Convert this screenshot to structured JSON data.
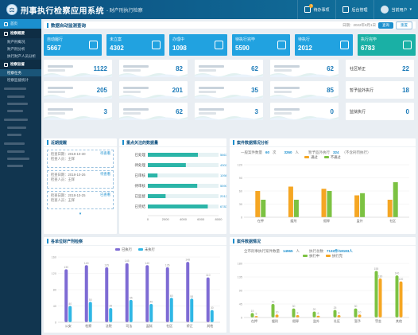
{
  "header": {
    "title": "刑事执行检察应用系统",
    "subtitle": "- 财产刑执行检察",
    "btn_tasks": "待办事项",
    "tasks_count": "1",
    "btn_manage": "后台管理",
    "user": "当前用户"
  },
  "sidebar": {
    "home": "首页",
    "overview_group": "检察概要",
    "items": [
      "财产刑概况",
      "财产刑分析",
      "执行财产人员分析"
    ],
    "data_group": "检察监督",
    "sel_items": [
      "检察任务",
      "检察监督统计"
    ]
  },
  "topbar": {
    "title": "数据自动监测查询",
    "date_text": "日期：2022年9月1日",
    "btn_query": "查询",
    "btn_reset": "重置"
  },
  "kpis": [
    {
      "label": "自动履行",
      "value": "5667"
    },
    {
      "label": "未立案",
      "value": "4302"
    },
    {
      "label": "办理中",
      "value": "1098"
    },
    {
      "label": "待执行完毕",
      "value": "5590"
    },
    {
      "label": "待执行",
      "value": "2012"
    },
    {
      "label": "执行完毕",
      "value": "6783"
    }
  ],
  "cards": [
    {
      "value": "1122"
    },
    {
      "value": "82"
    },
    {
      "value": "62"
    },
    {
      "value": "62"
    },
    {
      "label": "社区矫正",
      "value": "22"
    },
    {
      "value": "205"
    },
    {
      "value": "201"
    },
    {
      "value": "35"
    },
    {
      "value": "85"
    },
    {
      "label": "暂予监外执行",
      "value": "18"
    },
    {
      "value": "3"
    },
    {
      "value": "62"
    },
    {
      "value": "3"
    },
    {
      "value": "0"
    },
    {
      "label": "监狱执行",
      "value": "0"
    }
  ],
  "panels": {
    "recent": "近期提醒",
    "focus": "重点关注的数据量",
    "supervise": "案件数据情况分析",
    "compare": "各单位财产刑检察",
    "status": "案件数据情况"
  },
  "recent_items": [
    {
      "l1": "检查日期：2018-10-30",
      "l2": "检查人员：王辉",
      "tag": "待查看"
    },
    {
      "l1": "检查日期：2018-10-26",
      "l2": "检查人员：王辉",
      "tag": "待查看"
    },
    {
      "l1": "检查日期：2018-10-25",
      "l2": "检查人员：王辉",
      "tag": "已查看"
    }
  ],
  "focus_chart": {
    "type": "bar",
    "categories": [
      "已处理",
      "待处理",
      "已审核",
      "待审核",
      "已监督",
      "已完结"
    ],
    "values": [
      5667,
      4302,
      1098,
      5590,
      2012,
      6783
    ],
    "xticks": [
      "0",
      "2000",
      "4000",
      "6000",
      "8000"
    ],
    "xlim": [
      0,
      8000
    ]
  },
  "sup_head": {
    "t1": "一般案件数量",
    "v1": "60",
    "u1": "次",
    "v1b": "3260",
    "u1b": "人",
    "t2": "暂予监外执行",
    "v2": "324",
    "note": "（不含刑罚执行）"
  },
  "sup_chart": {
    "type": "bar",
    "categories": [
      "在押",
      "缓刑",
      "假释",
      "监外",
      "社区"
    ],
    "series": [
      {
        "name": "通过",
        "color": "#f5a623",
        "values": [
          60,
          70,
          65,
          50,
          40
        ]
      },
      {
        "name": "不通过",
        "color": "#7cc242",
        "values": [
          40,
          40,
          60,
          55,
          80
        ]
      }
    ],
    "ylim": [
      0,
      120
    ]
  },
  "cmp_chart": {
    "type": "bar",
    "categories": [
      "公安",
      "检察",
      "法院",
      "司法",
      "监狱",
      "社区",
      "矫正",
      "其他"
    ],
    "series": [
      {
        "name": "已执行",
        "color": "#7e6bd4",
        "values": [
          130,
          140,
          135,
          145,
          140,
          135,
          148,
          110
        ]
      },
      {
        "name": "未执行",
        "color": "#2fb7e5",
        "values": [
          40,
          50,
          35,
          55,
          45,
          60,
          58,
          30
        ]
      }
    ],
    "ylim": [
      0,
      160
    ]
  },
  "status_head": {
    "t1": "全市刑事执行案件数量",
    "v1": "14965",
    "u1": "人",
    "t2": "执行总数",
    "v2": "7132件/18183人"
  },
  "status_chart": {
    "type": "bar",
    "categories": [
      "在押",
      "缓刑",
      "假释",
      "监外",
      "社区",
      "暂予",
      "罚金",
      "其他"
    ],
    "series": [
      {
        "name": "执行中",
        "color": "#7cc242",
        "values": [
          15,
          45,
          30,
          20,
          25,
          30,
          155,
          140
        ]
      },
      {
        "name": "执行完",
        "color": "#f5a623",
        "values": [
          5,
          10,
          8,
          6,
          8,
          10,
          130,
          120
        ]
      }
    ],
    "ylim": [
      0,
      180
    ]
  }
}
